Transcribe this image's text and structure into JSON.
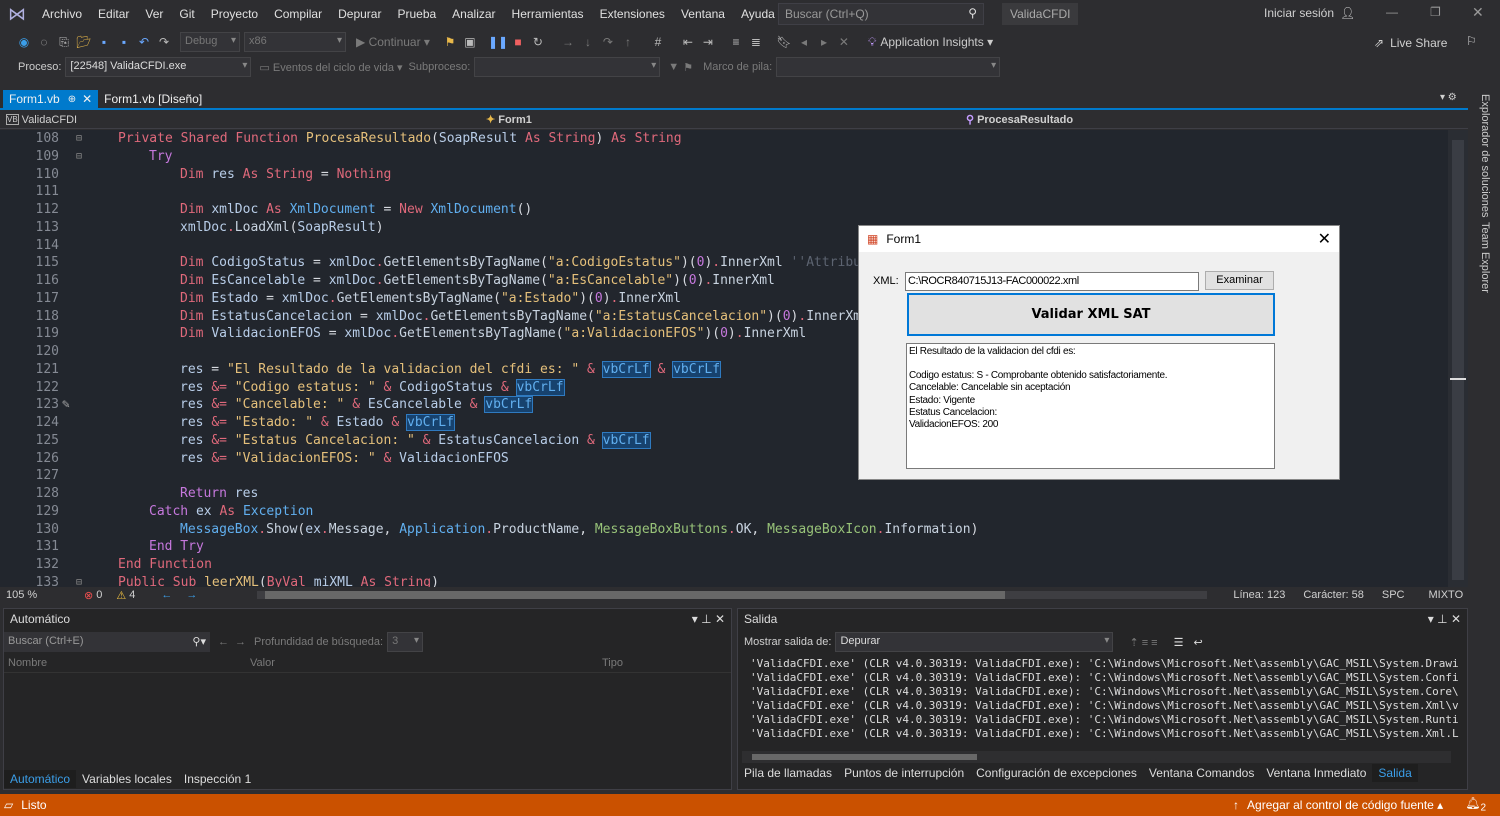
{
  "titlebar": {
    "menu": [
      "Archivo",
      "Editar",
      "Ver",
      "Git",
      "Proyecto",
      "Compilar",
      "Depurar",
      "Prueba",
      "Analizar",
      "Herramientas",
      "Extensiones",
      "Ventana",
      "Ayuda"
    ],
    "search_placeholder": "Buscar (Ctrl+Q)",
    "solution": "ValidaCFDI",
    "signin": "Iniciar sesión"
  },
  "toolbar": {
    "config": "Debug",
    "platform": "x86",
    "continue": "Continuar",
    "app_insights": "Application Insights",
    "live_share": "Live Share"
  },
  "debugbar": {
    "process_label": "Proceso:",
    "process": "[22548] ValidaCFDI.exe",
    "lifecycle": "Eventos del ciclo de vida",
    "thread_label": "Subproceso:",
    "stack_label": "Marco de pila:"
  },
  "tabs": [
    {
      "label": "Form1.vb",
      "active": true
    },
    {
      "label": "Form1.vb [Diseño]",
      "active": false
    }
  ],
  "navbar": {
    "project": "ValidaCFDI",
    "class": "Form1",
    "member": "ProcesaResultado"
  },
  "code": [
    {
      "n": "108",
      "ind": 0,
      "t": [
        [
          "Private Shared Function ",
          "kw"
        ],
        [
          "ProcesaResultado",
          "fn"
        ],
        [
          "(",
          "pu"
        ],
        [
          "SoapResult ",
          "id"
        ],
        [
          "As String",
          "kw"
        ],
        [
          ") ",
          "pu"
        ],
        [
          "As String",
          "kw"
        ]
      ]
    },
    {
      "n": "109",
      "ind": 1,
      "t": [
        [
          "Try",
          "fl"
        ]
      ]
    },
    {
      "n": "110",
      "ind": 2,
      "t": [
        [
          "Dim ",
          "kw"
        ],
        [
          "res ",
          "id"
        ],
        [
          "As String",
          "kw"
        ],
        [
          " = ",
          "pu"
        ],
        [
          "Nothing",
          "kw"
        ]
      ]
    },
    {
      "n": "111",
      "ind": 0,
      "t": []
    },
    {
      "n": "112",
      "ind": 2,
      "t": [
        [
          "Dim ",
          "kw"
        ],
        [
          "xmlDoc ",
          "id"
        ],
        [
          "As ",
          "kw"
        ],
        [
          "XmlDocument",
          "ty"
        ],
        [
          " = ",
          "pu"
        ],
        [
          "New ",
          "kw"
        ],
        [
          "XmlDocument",
          "ty"
        ],
        [
          "()",
          "pu"
        ]
      ]
    },
    {
      "n": "113",
      "ind": 2,
      "t": [
        [
          "xmlDoc",
          "id"
        ],
        [
          ".",
          "kw"
        ],
        [
          "LoadXml",
          "me"
        ],
        [
          "(",
          "pu"
        ],
        [
          "SoapResult",
          "id"
        ],
        [
          ")",
          "pu"
        ]
      ]
    },
    {
      "n": "114",
      "ind": 0,
      "t": []
    },
    {
      "n": "115",
      "ind": 2,
      "t": [
        [
          "Dim ",
          "kw"
        ],
        [
          "CodigoStatus",
          "id"
        ],
        [
          " = ",
          "pu"
        ],
        [
          "xmlDoc",
          "id"
        ],
        [
          ".",
          "kw"
        ],
        [
          "GetElementsByTagName",
          "me"
        ],
        [
          "(",
          "pu"
        ],
        [
          "\"a:CodigoEstatus\"",
          "st"
        ],
        [
          ")(",
          "pu"
        ],
        [
          "0",
          "nu"
        ],
        [
          ")",
          "pu"
        ],
        [
          ".",
          "kw"
        ],
        [
          "InnerXml",
          "me"
        ],
        [
          " ''Attribute",
          "cm"
        ]
      ]
    },
    {
      "n": "116",
      "ind": 2,
      "t": [
        [
          "Dim ",
          "kw"
        ],
        [
          "EsCancelable",
          "id"
        ],
        [
          " = ",
          "pu"
        ],
        [
          "xmlDoc",
          "id"
        ],
        [
          ".",
          "kw"
        ],
        [
          "GetElementsByTagName",
          "me"
        ],
        [
          "(",
          "pu"
        ],
        [
          "\"a:EsCancelable\"",
          "st"
        ],
        [
          ")(",
          "pu"
        ],
        [
          "0",
          "nu"
        ],
        [
          ")",
          "pu"
        ],
        [
          ".",
          "kw"
        ],
        [
          "InnerXml",
          "me"
        ]
      ]
    },
    {
      "n": "117",
      "ind": 2,
      "t": [
        [
          "Dim ",
          "kw"
        ],
        [
          "Estado",
          "id"
        ],
        [
          " = ",
          "pu"
        ],
        [
          "xmlDoc",
          "id"
        ],
        [
          ".",
          "kw"
        ],
        [
          "GetElementsByTagName",
          "me"
        ],
        [
          "(",
          "pu"
        ],
        [
          "\"a:Estado\"",
          "st"
        ],
        [
          ")(",
          "pu"
        ],
        [
          "0",
          "nu"
        ],
        [
          ")",
          "pu"
        ],
        [
          ".",
          "kw"
        ],
        [
          "InnerXml",
          "me"
        ]
      ]
    },
    {
      "n": "118",
      "ind": 2,
      "t": [
        [
          "Dim ",
          "kw"
        ],
        [
          "EstatusCancelacion",
          "id"
        ],
        [
          " = ",
          "pu"
        ],
        [
          "xmlDoc",
          "id"
        ],
        [
          ".",
          "kw"
        ],
        [
          "GetElementsByTagName",
          "me"
        ],
        [
          "(",
          "pu"
        ],
        [
          "\"a:EstatusCancelacion\"",
          "st"
        ],
        [
          ")(",
          "pu"
        ],
        [
          "0",
          "nu"
        ],
        [
          ")",
          "pu"
        ],
        [
          ".",
          "kw"
        ],
        [
          "InnerXml",
          "me"
        ]
      ]
    },
    {
      "n": "119",
      "ind": 2,
      "t": [
        [
          "Dim ",
          "kw"
        ],
        [
          "ValidacionEFOS",
          "id"
        ],
        [
          " = ",
          "pu"
        ],
        [
          "xmlDoc",
          "id"
        ],
        [
          ".",
          "kw"
        ],
        [
          "GetElementsByTagName",
          "me"
        ],
        [
          "(",
          "pu"
        ],
        [
          "\"a:ValidacionEFOS\"",
          "st"
        ],
        [
          ")(",
          "pu"
        ],
        [
          "0",
          "nu"
        ],
        [
          ")",
          "pu"
        ],
        [
          ".",
          "kw"
        ],
        [
          "InnerXml",
          "me"
        ]
      ]
    },
    {
      "n": "120",
      "ind": 0,
      "t": []
    },
    {
      "n": "121",
      "ind": 2,
      "t": [
        [
          "res",
          "id"
        ],
        [
          " = ",
          "pu"
        ],
        [
          "\"El Resultado de la validacion del cfdi es: \"",
          "st"
        ],
        [
          " & ",
          "kw"
        ],
        [
          "vbCrLf",
          "hl"
        ],
        [
          " & ",
          "kw"
        ],
        [
          "vbCrLf",
          "hl"
        ]
      ]
    },
    {
      "n": "122",
      "ind": 2,
      "t": [
        [
          "res ",
          "id"
        ],
        [
          "&=",
          "kw"
        ],
        [
          " \"Codigo estatus: \"",
          "st"
        ],
        [
          " & ",
          "kw"
        ],
        [
          "CodigoStatus",
          "id"
        ],
        [
          " & ",
          "kw"
        ],
        [
          "vbCrLf",
          "hl"
        ]
      ]
    },
    {
      "n": "123",
      "ind": 2,
      "t": [
        [
          "res ",
          "id"
        ],
        [
          "&=",
          "kw"
        ],
        [
          " \"Cancelable: \"",
          "st"
        ],
        [
          " & ",
          "kw"
        ],
        [
          "EsCancelable",
          "id"
        ],
        [
          " & ",
          "kw"
        ],
        [
          "vbCrLf",
          "hl"
        ]
      ]
    },
    {
      "n": "124",
      "ind": 2,
      "t": [
        [
          "res ",
          "id"
        ],
        [
          "&=",
          "kw"
        ],
        [
          " \"Estado: \"",
          "st"
        ],
        [
          " & ",
          "kw"
        ],
        [
          "Estado",
          "id"
        ],
        [
          " & ",
          "kw"
        ],
        [
          "vbCrLf",
          "hl"
        ]
      ]
    },
    {
      "n": "125",
      "ind": 2,
      "t": [
        [
          "res ",
          "id"
        ],
        [
          "&=",
          "kw"
        ],
        [
          " \"Estatus Cancelacion: \"",
          "st"
        ],
        [
          " & ",
          "kw"
        ],
        [
          "EstatusCancelacion",
          "id"
        ],
        [
          " & ",
          "kw"
        ],
        [
          "vbCrLf",
          "hl"
        ]
      ]
    },
    {
      "n": "126",
      "ind": 2,
      "t": [
        [
          "res ",
          "id"
        ],
        [
          "&=",
          "kw"
        ],
        [
          " \"ValidacionEFOS: \"",
          "st"
        ],
        [
          " & ",
          "kw"
        ],
        [
          "ValidacionEFOS",
          "id"
        ]
      ]
    },
    {
      "n": "127",
      "ind": 0,
      "t": []
    },
    {
      "n": "128",
      "ind": 2,
      "t": [
        [
          "Return ",
          "fl"
        ],
        [
          "res",
          "id"
        ]
      ]
    },
    {
      "n": "129",
      "ind": 1,
      "t": [
        [
          "Catch ",
          "fl"
        ],
        [
          "ex ",
          "id"
        ],
        [
          "As ",
          "kw"
        ],
        [
          "Exception",
          "ty"
        ]
      ]
    },
    {
      "n": "130",
      "ind": 2,
      "t": [
        [
          "MessageBox",
          "ty"
        ],
        [
          ".",
          "kw"
        ],
        [
          "Show",
          "me"
        ],
        [
          "(",
          "pu"
        ],
        [
          "ex",
          "id"
        ],
        [
          ".",
          "kw"
        ],
        [
          "Message",
          "me"
        ],
        [
          ", ",
          "pu"
        ],
        [
          "Application",
          "ty"
        ],
        [
          ".",
          "kw"
        ],
        [
          "ProductName",
          "me"
        ],
        [
          ", ",
          "pu"
        ],
        [
          "MessageBoxButtons",
          "gr"
        ],
        [
          ".",
          "kw"
        ],
        [
          "OK",
          "me"
        ],
        [
          ", ",
          "pu"
        ],
        [
          "MessageBoxIcon",
          "gr"
        ],
        [
          ".",
          "kw"
        ],
        [
          "Information",
          "me"
        ],
        [
          ")",
          "pu"
        ]
      ]
    },
    {
      "n": "131",
      "ind": 1,
      "t": [
        [
          "End Try",
          "fl"
        ]
      ]
    },
    {
      "n": "132",
      "ind": 0,
      "t": [
        [
          "End Function",
          "kw"
        ]
      ]
    },
    {
      "n": "133",
      "ind": 0,
      "t": [
        [
          "Public Sub ",
          "kw"
        ],
        [
          "leerXML",
          "fn"
        ],
        [
          "(",
          "pu"
        ],
        [
          "ByVal ",
          "kw"
        ],
        [
          "miXML ",
          "id"
        ],
        [
          "As String",
          "kw"
        ],
        [
          ")",
          "pu"
        ]
      ]
    }
  ],
  "editor_status": {
    "zoom": "105 %",
    "errors": "0",
    "warnings": "4",
    "line": "Línea: 123",
    "char": "Carácter: 58",
    "spc": "SPC",
    "mode": "MIXTO"
  },
  "sidetabs": [
    "Explorador de soluciones",
    "Team Explorer"
  ],
  "autos": {
    "title": "Automático",
    "search_placeholder": "Buscar (Ctrl+E)",
    "depth_label": "Profundidad de búsqueda:",
    "depth": "3",
    "columns": [
      "Nombre",
      "Valor",
      "Tipo"
    ],
    "tabs": [
      "Automático",
      "Variables locales",
      "Inspección 1"
    ]
  },
  "output": {
    "title": "Salida",
    "show_label": "Mostrar salida de:",
    "source": "Depurar",
    "lines": [
      "'ValidaCFDI.exe' (CLR v4.0.30319: ValidaCFDI.exe): 'C:\\Windows\\Microsoft.Net\\assembly\\GAC_MSIL\\System.Drawi",
      "'ValidaCFDI.exe' (CLR v4.0.30319: ValidaCFDI.exe): 'C:\\Windows\\Microsoft.Net\\assembly\\GAC_MSIL\\System.Confi",
      "'ValidaCFDI.exe' (CLR v4.0.30319: ValidaCFDI.exe): 'C:\\Windows\\Microsoft.Net\\assembly\\GAC_MSIL\\System.Core\\",
      "'ValidaCFDI.exe' (CLR v4.0.30319: ValidaCFDI.exe): 'C:\\Windows\\Microsoft.Net\\assembly\\GAC_MSIL\\System.Xml\\v",
      "'ValidaCFDI.exe' (CLR v4.0.30319: ValidaCFDI.exe): 'C:\\Windows\\Microsoft.Net\\assembly\\GAC_MSIL\\System.Runti",
      "'ValidaCFDI.exe' (CLR v4.0.30319: ValidaCFDI.exe): 'C:\\Windows\\Microsoft.Net\\assembly\\GAC_MSIL\\System.Xml.L"
    ],
    "tabs": [
      "Pila de llamadas",
      "Puntos de interrupción",
      "Configuración de excepciones",
      "Ventana Comandos",
      "Ventana Inmediato",
      "Salida"
    ]
  },
  "statusbar": {
    "ready": "Listo",
    "source_control": "Agregar al control de código fuente",
    "notifications": "2",
    "color": "#ca5100"
  },
  "dialog": {
    "title": "Form1",
    "xml_label": "XML:",
    "xml_value": "C:\\ROCR840715J13-FAC000022.xml",
    "browse": "Examinar",
    "validate": "Validar XML SAT",
    "result_lines": [
      "El Resultado de la validacion del cfdi es:",
      "",
      "Codigo estatus: S - Comprobante obtenido satisfactoriamente.",
      "Cancelable: Cancelable sin aceptación",
      "Estado: Vigente",
      "Estatus Cancelacion:",
      "ValidacionEFOS: 200"
    ]
  }
}
